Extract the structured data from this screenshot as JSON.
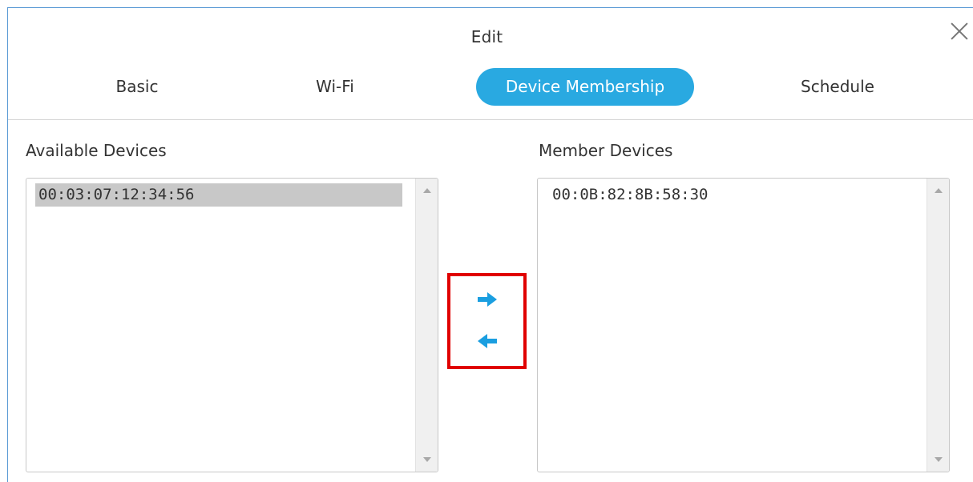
{
  "dialog": {
    "title": "Edit"
  },
  "tabs": [
    {
      "label": "Basic",
      "active": false
    },
    {
      "label": "Wi-Fi",
      "active": false
    },
    {
      "label": "Device Membership",
      "active": true
    },
    {
      "label": "Schedule",
      "active": false
    }
  ],
  "available": {
    "label": "Available Devices",
    "items": [
      "00:03:07:12:34:56"
    ],
    "selected_index": 0
  },
  "member": {
    "label": "Member Devices",
    "items": [
      "00:0B:82:8B:58:30"
    ]
  },
  "icons": {
    "close": "close-icon",
    "add": "arrow-right-icon",
    "remove": "arrow-left-icon"
  },
  "colors": {
    "active_tab": "#29a9e1",
    "arrow": "#1a9ee0",
    "highlight_box": "#e00000",
    "selected_item": "#c8c8c8"
  }
}
